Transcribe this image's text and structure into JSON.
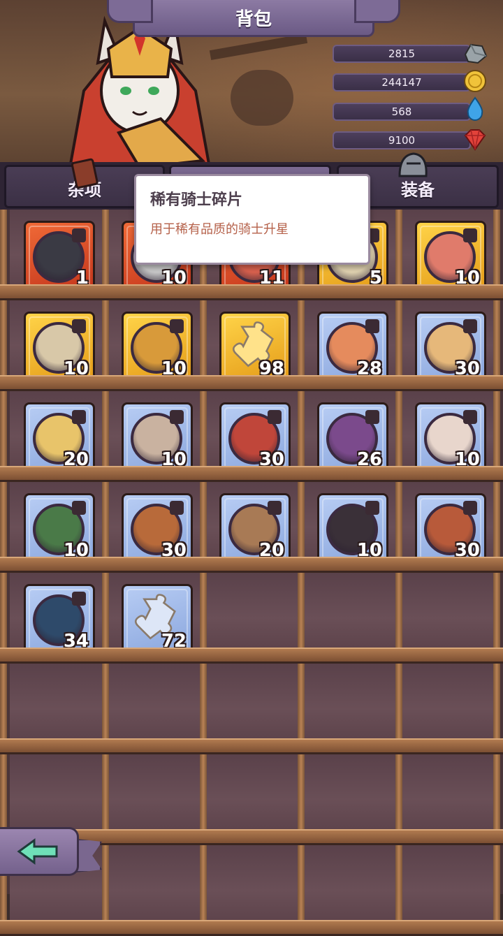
{
  "header": {
    "title": "背包"
  },
  "currencies": [
    {
      "value": "2815",
      "icon": "stone-icon",
      "color": "#9aa3a8"
    },
    {
      "value": "244147",
      "icon": "gold-coin-icon",
      "color": "#f0c33a"
    },
    {
      "value": "568",
      "icon": "water-drop-icon",
      "color": "#3fa4e8"
    },
    {
      "value": "9100",
      "icon": "red-gem-icon",
      "color": "#e2423a"
    }
  ],
  "tabs": [
    {
      "label": "杂项",
      "active": false
    },
    {
      "label": "",
      "active": true
    },
    {
      "label": "",
      "active": false
    },
    {
      "label": "装备",
      "active": false
    }
  ],
  "tooltip": {
    "title": "稀有骑士碎片",
    "description": "用于稀有品质的骑士升星"
  },
  "items": [
    {
      "rarity": "red",
      "kind": "portrait",
      "qty": "1",
      "face": "#3a3a44"
    },
    {
      "rarity": "red",
      "kind": "portrait",
      "qty": "10",
      "face": "#c8c8c8"
    },
    {
      "rarity": "red",
      "kind": "portrait",
      "qty": "11",
      "face": "#d9614e"
    },
    {
      "rarity": "gold",
      "kind": "portrait",
      "qty": "5",
      "face": "#e0d2b0"
    },
    {
      "rarity": "gold",
      "kind": "portrait",
      "qty": "10",
      "face": "#e07b6b"
    },
    {
      "rarity": "gold",
      "kind": "portrait",
      "qty": "10",
      "face": "#d8c8a8"
    },
    {
      "rarity": "gold",
      "kind": "portrait",
      "qty": "10",
      "face": "#d89a3a"
    },
    {
      "rarity": "gold",
      "kind": "piece",
      "qty": "98",
      "face": "#ffe28a"
    },
    {
      "rarity": "blue",
      "kind": "portrait",
      "qty": "28",
      "face": "#e58b5d"
    },
    {
      "rarity": "blue",
      "kind": "portrait",
      "qty": "30",
      "face": "#e6b87a"
    },
    {
      "rarity": "blue",
      "kind": "portrait",
      "qty": "20",
      "face": "#e8c46a"
    },
    {
      "rarity": "blue",
      "kind": "portrait",
      "qty": "10",
      "face": "#c9b2a0"
    },
    {
      "rarity": "blue",
      "kind": "portrait",
      "qty": "30",
      "face": "#c0463a"
    },
    {
      "rarity": "blue",
      "kind": "portrait",
      "qty": "26",
      "face": "#7b4a8c"
    },
    {
      "rarity": "blue",
      "kind": "portrait",
      "qty": "10",
      "face": "#e8d6cc"
    },
    {
      "rarity": "blue",
      "kind": "portrait",
      "qty": "10",
      "face": "#4a7a48"
    },
    {
      "rarity": "blue",
      "kind": "portrait",
      "qty": "30",
      "face": "#b86a3a"
    },
    {
      "rarity": "blue",
      "kind": "portrait",
      "qty": "20",
      "face": "#a87a55"
    },
    {
      "rarity": "blue",
      "kind": "portrait",
      "qty": "10",
      "face": "#3a3038"
    },
    {
      "rarity": "blue",
      "kind": "portrait",
      "qty": "30",
      "face": "#b85a3a"
    },
    {
      "rarity": "blue",
      "kind": "portrait",
      "qty": "34",
      "face": "#2e4a6a"
    },
    {
      "rarity": "blue",
      "kind": "piece",
      "qty": "72",
      "face": "#dde6f7"
    }
  ],
  "back_button": {
    "icon": "back-arrow-icon",
    "color": "#6fe0b8"
  }
}
